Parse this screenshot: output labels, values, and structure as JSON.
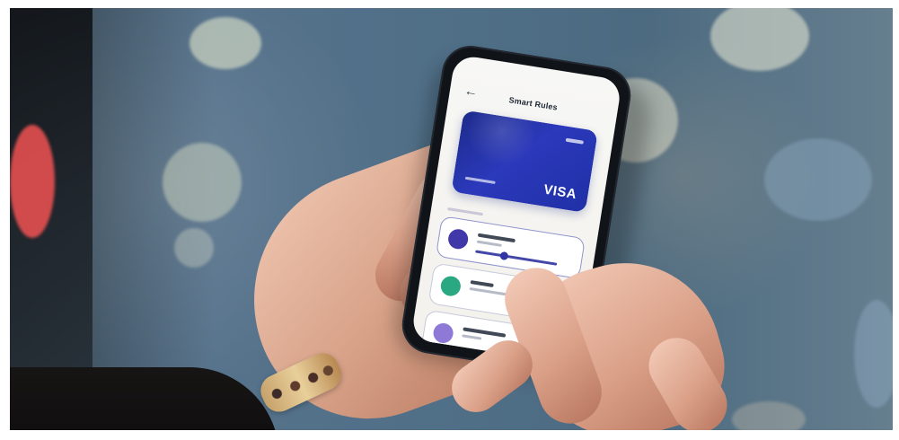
{
  "scene": {
    "description": "",
    "phone_ui": {
      "screen_title": "Smart Rules",
      "card_brand": "VISA",
      "option_1_label": "",
      "option_2_label": "",
      "option_3_label": ""
    }
  },
  "colors": {
    "card_blue": "#2233aa",
    "accent_indigo": "#3035a3",
    "accent_green": "#26a57b",
    "accent_purple": "#8c7ad1"
  }
}
